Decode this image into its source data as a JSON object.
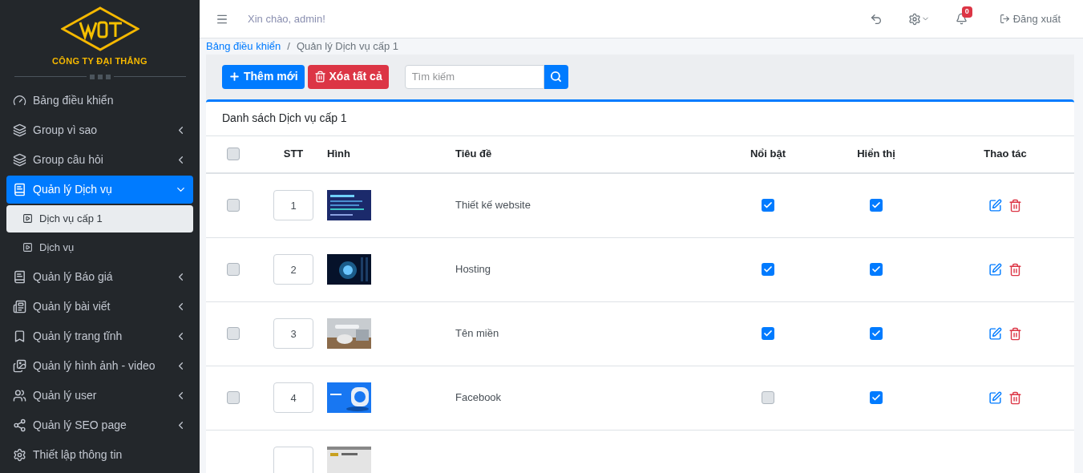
{
  "brand": {
    "company": "CÔNG TY ĐẠI THẮNG"
  },
  "sidebar": {
    "items": [
      {
        "label": "Bảng điều khiển",
        "has_children": false,
        "selected": false
      },
      {
        "label": "Group vì sao",
        "has_children": true,
        "expanded": false,
        "selected": false
      },
      {
        "label": "Group câu hỏi",
        "has_children": true,
        "expanded": false,
        "selected": false
      },
      {
        "label": "Quản lý Dịch vụ",
        "has_children": true,
        "expanded": true,
        "selected": true,
        "children": [
          {
            "label": "Dịch vụ cấp 1",
            "selected": true
          },
          {
            "label": "Dịch vụ",
            "selected": false
          }
        ]
      },
      {
        "label": "Quản lý Báo giá",
        "has_children": true,
        "expanded": false,
        "selected": false
      },
      {
        "label": "Quản lý bài viết",
        "has_children": true,
        "expanded": false,
        "selected": false
      },
      {
        "label": "Quản lý trang tĩnh",
        "has_children": true,
        "expanded": false,
        "selected": false
      },
      {
        "label": "Quản lý hình ảnh - video",
        "has_children": true,
        "expanded": false,
        "selected": false
      },
      {
        "label": "Quản lý user",
        "has_children": true,
        "expanded": false,
        "selected": false
      },
      {
        "label": "Quản lý SEO page",
        "has_children": true,
        "expanded": false,
        "selected": false
      },
      {
        "label": "Thiết lập thông tin",
        "has_children": false,
        "selected": false
      }
    ]
  },
  "header": {
    "greeting": "Xin chào, admin!",
    "notification_count": "0",
    "logout": "Đăng xuất"
  },
  "breadcrumb": {
    "separator": "/",
    "items": [
      {
        "label": "Bảng điều khiển",
        "kind": "link"
      },
      {
        "label": "Quản lý Dịch vụ cấp 1",
        "kind": "current"
      }
    ]
  },
  "toolbar": {
    "add": "Thêm mới",
    "delete_all": "Xóa tất cả",
    "search": {
      "placeholder": "Tìm kiếm"
    }
  },
  "table": {
    "title": "Danh sách Dịch vụ cấp 1",
    "select_all": {
      "checked": false
    },
    "columns": [
      "STT",
      "Hình",
      "Tiêu đề",
      "Nổi bật",
      "Hiển thị",
      "Thao tác"
    ],
    "rows": [
      {
        "stt": "1",
        "title": "Thiết kế website",
        "featured": true,
        "visible": true,
        "checked": false,
        "image": {
          "kind": "picture"
        }
      },
      {
        "stt": "2",
        "title": "Hosting",
        "featured": true,
        "visible": true,
        "checked": false,
        "image": {
          "kind": "picture"
        }
      },
      {
        "stt": "3",
        "title": "Tên miền",
        "featured": true,
        "visible": true,
        "checked": false,
        "image": {
          "kind": "picture"
        }
      },
      {
        "stt": "4",
        "title": "Facebook",
        "featured": false,
        "visible": true,
        "checked": false,
        "image": {
          "kind": "picture"
        }
      },
      {
        "image": {
          "kind": "picture"
        }
      }
    ]
  }
}
